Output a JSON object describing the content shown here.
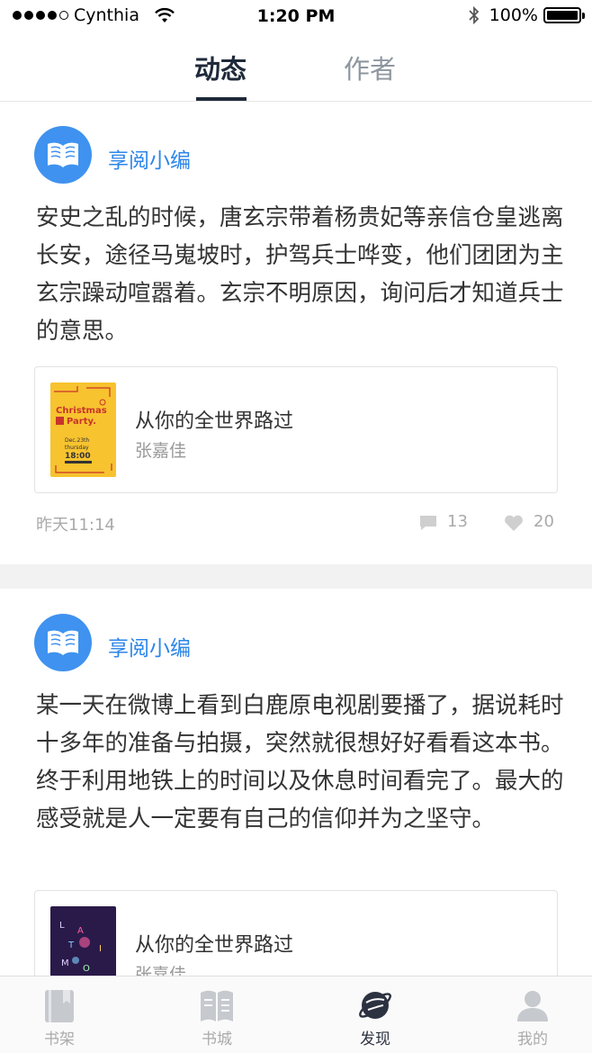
{
  "status_bar": {
    "carrier": "Cynthia",
    "time": "1:20 PM",
    "battery": "100%",
    "battery_level": 1.0
  },
  "top_tabs": [
    {
      "label": "动态",
      "active": true
    },
    {
      "label": "作者",
      "active": false
    }
  ],
  "posts": [
    {
      "author": "享阅小编",
      "text": "安史之乱的时候，唐玄宗带着杨贵妃等亲信仓皇逃离长安，途径马嵬坡时，护驾兵士哗变，他们团团为主玄宗躁动喧嚣着。玄宗不明原因，询问后才知道兵士的意思。",
      "book": {
        "title": "从你的全世界路过",
        "author": "张嘉佳",
        "cover_text": [
          "Christmas",
          "Party.",
          "Dec.23th",
          "thursday",
          "18:00"
        ]
      },
      "time": "昨天11:14",
      "comments": "13",
      "likes": "20"
    },
    {
      "author": "享阅小编",
      "text": "某一天在微博上看到白鹿原电视剧要播了，据说耗时十多年的准备与拍摄，突然就很想好好看看这本书。终于利用地铁上的时间以及休息时间看完了。最大的感受就是人一定要有自己的信仰并为之坚守。",
      "book": {
        "title": "从你的全世界路过",
        "author": "张嘉佳",
        "cover_text": [
          "L",
          "A",
          "T",
          "I",
          "M",
          "O"
        ]
      }
    }
  ],
  "tab_bar": [
    {
      "label": "书架",
      "icon": "bookshelf-icon",
      "active": false
    },
    {
      "label": "书城",
      "icon": "bookstore-icon",
      "active": false
    },
    {
      "label": "发现",
      "icon": "planet-icon",
      "active": true
    },
    {
      "label": "我的",
      "icon": "profile-icon",
      "active": false
    }
  ],
  "colors": {
    "accent_blue": "#2d86e8",
    "avatar_blue": "#3f92ef",
    "active_dark": "#1f2a3a",
    "inactive_gray": "#8e96a0"
  }
}
